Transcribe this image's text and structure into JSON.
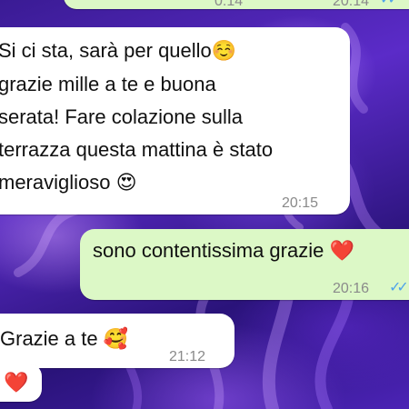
{
  "chat": {
    "messages": [
      {
        "direction": "outgoing",
        "lines": [
          "",
          ""
        ],
        "time": "20:14",
        "read": true
      },
      {
        "direction": "incoming",
        "lines": [
          "Si ci sta, sarà per quello",
          "grazie mille a te e buona",
          "serata! Fare colazione sulla",
          "terrazza questa mattina è stato",
          "meraviglioso"
        ],
        "emoji_line1": "☺️",
        "emoji_line5": "😍",
        "time": "20:15"
      },
      {
        "direction": "outgoing",
        "text": "sono contentissima grazie",
        "emoji": "❤️",
        "time": "20:16",
        "read": true
      },
      {
        "direction": "incoming",
        "text": "Grazie a te",
        "emoji": "🥰",
        "time": "21:12"
      },
      {
        "direction": "incoming",
        "emoji": "❤️"
      }
    ],
    "partial_top_times": {
      "left": "0:14",
      "right": "20:14"
    }
  },
  "colors": {
    "incoming_bubble": "#ffffff",
    "outgoing_bubble": "#dcf8c6",
    "read_tick": "#4fa3ea",
    "heart": "#e0152b"
  },
  "icons": {
    "read_receipt": "double-check-icon"
  }
}
